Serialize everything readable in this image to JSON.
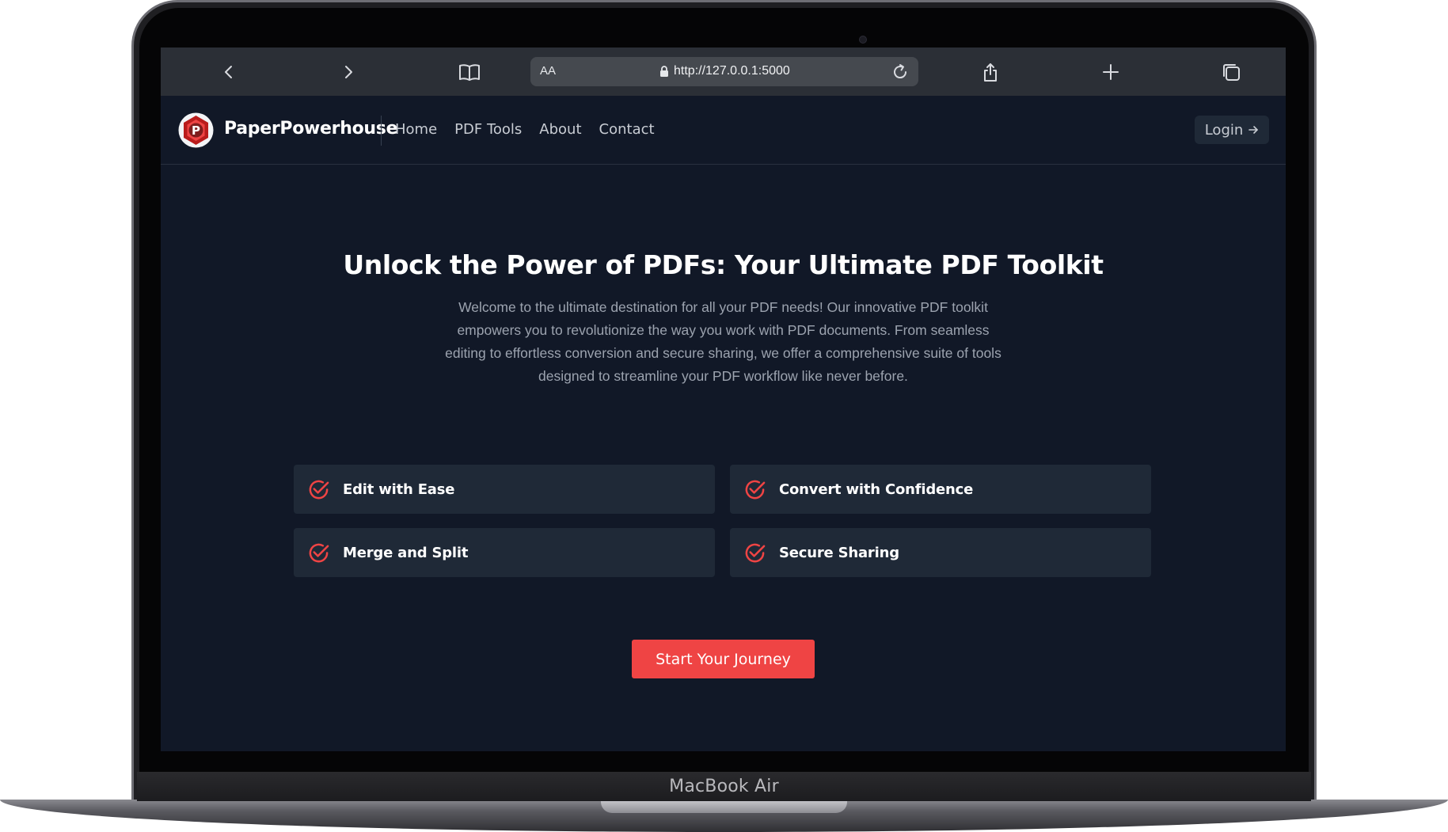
{
  "device": {
    "label": "MacBook Air"
  },
  "browser": {
    "text_size_label": "AA",
    "url": "http://127.0.0.1:5000",
    "icons": [
      "back-icon",
      "forward-icon",
      "bookmarks-icon",
      "lock-icon",
      "reload-icon",
      "share-icon",
      "new-tab-icon",
      "tabs-icon"
    ]
  },
  "nav": {
    "brand": "PaperPowerhouse",
    "links": [
      "Home",
      "PDF Tools",
      "About",
      "Contact"
    ],
    "login_label": "Login"
  },
  "hero": {
    "title": "Unlock the Power of PDFs: Your Ultimate PDF Toolkit",
    "description": "Welcome to the ultimate destination for all your PDF needs! Our innovative PDF toolkit empowers you to revolutionize the way you work with PDF documents. From seamless editing to effortless conversion and secure sharing, we offer a comprehensive suite of tools designed to streamline your PDF workflow like never before."
  },
  "features": [
    {
      "label": "Edit with Ease",
      "icon": "check-circle-icon"
    },
    {
      "label": "Convert with Confidence",
      "icon": "check-circle-icon"
    },
    {
      "label": "Merge and Split",
      "icon": "check-circle-icon"
    },
    {
      "label": "Secure Sharing",
      "icon": "check-circle-icon"
    }
  ],
  "cta": {
    "label": "Start Your Journey"
  },
  "colors": {
    "background": "#111827",
    "card": "#1f2937",
    "accent": "#ef4444",
    "muted_text": "#9ca3af"
  }
}
